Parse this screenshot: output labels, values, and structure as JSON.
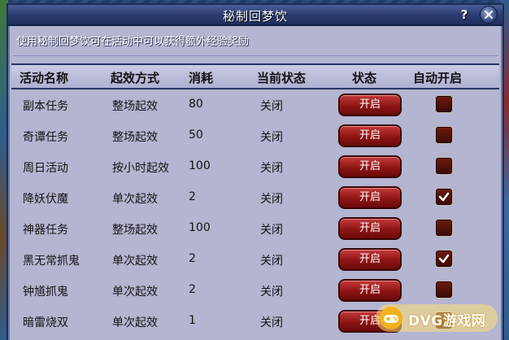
{
  "window": {
    "title": "秘制回梦饮",
    "help_label": "?",
    "intro": "使用秘制回梦饮可在活动中可以获得额外经验奖励"
  },
  "table": {
    "headers": [
      "活动名称",
      "起效方式",
      "消耗",
      "当前状态",
      "状态",
      "自动开启"
    ],
    "rows": [
      {
        "name": "副本任务",
        "mode": "整场起效",
        "cost": "80",
        "status": "关闭",
        "button": "开启",
        "auto": false
      },
      {
        "name": "奇谭任务",
        "mode": "整场起效",
        "cost": "50",
        "status": "关闭",
        "button": "开启",
        "auto": false
      },
      {
        "name": "周日活动",
        "mode": "按小时起效",
        "cost": "100",
        "status": "关闭",
        "button": "开启",
        "auto": false
      },
      {
        "name": "降妖伏魔",
        "mode": "单次起效",
        "cost": "2",
        "status": "关闭",
        "button": "开启",
        "auto": true
      },
      {
        "name": "神器任务",
        "mode": "整场起效",
        "cost": "100",
        "status": "关闭",
        "button": "开启",
        "auto": false
      },
      {
        "name": "黑无常抓鬼",
        "mode": "单次起效",
        "cost": "2",
        "status": "关闭",
        "button": "开启",
        "auto": true
      },
      {
        "name": "钟馗抓鬼",
        "mode": "单次起效",
        "cost": "2",
        "status": "关闭",
        "button": "开启",
        "auto": false
      },
      {
        "name": "暗雷烧双",
        "mode": "单次起效",
        "cost": "1",
        "status": "关闭",
        "button": "开启",
        "auto": false
      }
    ]
  },
  "watermark": {
    "text": "DVG游戏网",
    "icon": "gamepad-icon"
  },
  "colors": {
    "window_bg": "#b3b5d1",
    "titlebar": "#2c3d73",
    "button_red": "#8e1414",
    "checkbox_bg": "#3c0a05"
  }
}
